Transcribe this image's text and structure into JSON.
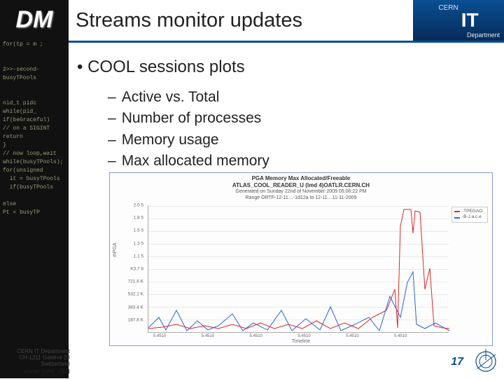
{
  "header": {
    "title": "Streams monitor updates",
    "dm_label": "DM",
    "cern_small": "CERN",
    "it_label": "IT",
    "department": "Department"
  },
  "bullets": {
    "main": "COOL sessions plots",
    "subs": [
      "Active vs. Total",
      "Number of processes",
      "Memory usage",
      "Max allocated memory"
    ]
  },
  "chart_data": {
    "type": "line",
    "title_line1": "PGA Memory Max Allocated/Freeable",
    "title_line2": "ATLAS_COOL_READER_U (lmd 4)OATLR.CERN.CH",
    "subtitle": "Generated on Sunday 22nd of November 2009 05:06:22 PM",
    "range_note": "Range ORTF-12-11…-1d12a  to  12-11…11-11-2009",
    "xlabel": "Timeline",
    "ylabel": "mPGA",
    "ylim": [
      0,
      2.0
    ],
    "yticks": [
      0.0,
      187.8,
      383.4,
      532.1,
      721.6,
      837.8,
      1.15,
      1.35,
      1.55,
      1.85,
      2.0
    ],
    "ytick_labels": [
      "",
      "187.8 K",
      "383.4 K",
      "532.1 K",
      "721.6 K",
      "K3.7 8",
      "1.1 5",
      "1.3 5",
      "1.5 5",
      "1.8 5",
      "2.0 5"
    ],
    "x_categories": [
      "5.4510",
      "5.4510",
      "5.4510",
      "5.4510",
      "5.4510",
      "5.4510",
      "5.4510",
      "5.4510",
      "5.4510",
      "5.4510",
      "5.4510",
      "5.4510"
    ],
    "legend": [
      "-TPEGAO",
      "-B-J.a.c.e"
    ],
    "series": [
      {
        "name": "-TPEGAO",
        "color": "#dc2626"
      },
      {
        "name": "-B-J.a.c.e",
        "color": "#2563eb"
      }
    ],
    "notes": "Two spiky time-series; red rises sharply near right edge approaching 2.0×10^5; blue baseline low with small spikes."
  },
  "footer": {
    "line1": "CERN IT Department",
    "line2": "CH-1211 Genève 23",
    "line3": "Switzerland",
    "url": "www. cern. ch/it"
  },
  "page_number": "17",
  "sidebar_code": "for(tp = m ;\n\n\n2>>-second-\nbusyTPools\n\n\nnid_t pidc\nwhile(pid_\nif(beGraceful)\n// on a SIGINT\nreturn\n}\n// now loop,wait\nwhile(busyTPools);\nfor(unsigned\n  it = busyTPools\n  if(busyTPools\n\nelse\nPt = busyTP"
}
